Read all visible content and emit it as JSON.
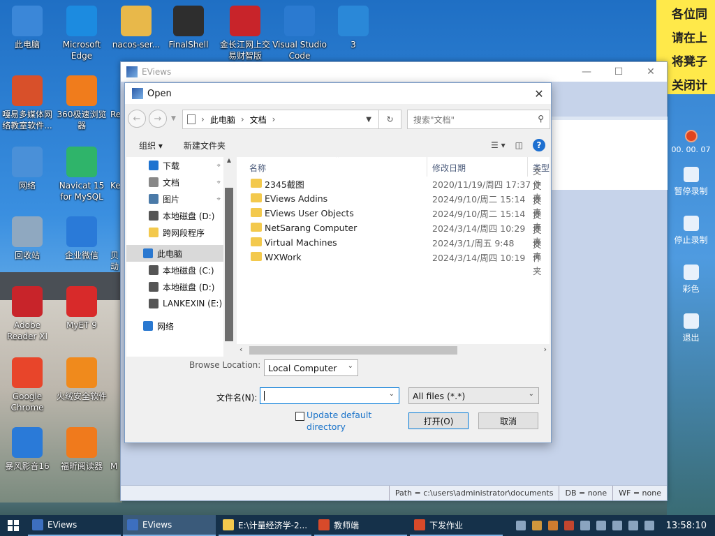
{
  "desktop": {
    "icons": [
      {
        "label": "此电脑",
        "name": "this-pc-icon"
      },
      {
        "label": "Microsoft Edge",
        "name": "edge-icon"
      },
      {
        "label": "nacos-ser...",
        "name": "folder-icon"
      },
      {
        "label": "FinalShell",
        "name": "finalshell-icon"
      },
      {
        "label": "金长江网上交易财智版",
        "name": "trading-app-icon"
      },
      {
        "label": "Visual Studio Code",
        "name": "vscode-icon"
      },
      {
        "label": "3",
        "name": "video-file-icon"
      },
      {
        "label": "嘎易多媒体网络教室软件...",
        "name": "classroom-app-icon"
      },
      {
        "label": "360极速浏览器",
        "name": "browser-360-icon"
      },
      {
        "label": "Re",
        "name": "app-icon"
      },
      {
        "label": "网络",
        "name": "network-icon"
      },
      {
        "label": "Navicat 15 for MySQL",
        "name": "navicat-icon"
      },
      {
        "label": "Ke",
        "name": "app-icon"
      },
      {
        "label": "回收站",
        "name": "recycle-bin-icon"
      },
      {
        "label": "企业微信",
        "name": "wecom-icon"
      },
      {
        "label": "贝动",
        "name": "app-icon"
      },
      {
        "label": "Adobe Reader XI",
        "name": "adobe-reader-icon"
      },
      {
        "label": "MyET 9",
        "name": "myet-icon"
      },
      {
        "label": "Google Chrome",
        "name": "chrome-icon"
      },
      {
        "label": "火绒安全软件",
        "name": "huorong-icon"
      },
      {
        "label": "暴风影音16",
        "name": "baofeng-icon"
      },
      {
        "label": "福昕阅读器",
        "name": "foxit-icon"
      },
      {
        "label": "M",
        "name": "app-icon"
      }
    ],
    "sticky_note": [
      "各位同",
      "请在上",
      "将凳子",
      "关闭计"
    ],
    "recorder": {
      "time": "00. 00. 07",
      "pause": "暂停录制",
      "stop": "停止录制",
      "color": "彩色",
      "exit": "退出"
    }
  },
  "eviews": {
    "title": "EViews",
    "status": {
      "path": "Path = c:\\users\\administrator\\documents",
      "db": "DB = none",
      "wf": "WF = none"
    }
  },
  "dialog": {
    "title": "Open",
    "address": {
      "root": "此电脑",
      "folder": "文档"
    },
    "search_placeholder": "搜索\"文档\"",
    "toolbar": {
      "organize": "组织 ▾",
      "new_folder": "新建文件夹"
    },
    "nav": [
      {
        "label": "下载",
        "pinned": true
      },
      {
        "label": "文档",
        "pinned": true
      },
      {
        "label": "图片",
        "pinned": true
      },
      {
        "label": "本地磁盘 (D:)",
        "pinned": false
      },
      {
        "label": "跨网段程序",
        "pinned": false
      },
      {
        "label": "此电脑",
        "pinned": false,
        "selected": true
      },
      {
        "label": "本地磁盘 (C:)",
        "pinned": false
      },
      {
        "label": "本地磁盘 (D:)",
        "pinned": false
      },
      {
        "label": "LANKEXIN (E:)",
        "pinned": false
      },
      {
        "label": "网络",
        "pinned": false
      }
    ],
    "columns": {
      "name": "名称",
      "date": "修改日期",
      "type": "类型"
    },
    "files": [
      {
        "name": "2345截图",
        "date": "2020/11/19/周四 17:37",
        "type": "文件夹"
      },
      {
        "name": "EViews Addins",
        "date": "2024/9/10/周二 15:14",
        "type": "文件夹"
      },
      {
        "name": "EViews User Objects",
        "date": "2024/9/10/周二 15:14",
        "type": "文件夹"
      },
      {
        "name": "NetSarang Computer",
        "date": "2024/3/14/周四 10:29",
        "type": "文件夹"
      },
      {
        "name": "Virtual Machines",
        "date": "2024/3/1/周五 9:48",
        "type": "文件夹"
      },
      {
        "name": "WXWork",
        "date": "2024/3/14/周四 10:19",
        "type": "文件夹"
      }
    ],
    "browse_location_label": "Browse Location:",
    "browse_location_value": "Local Computer",
    "filename_label": "文件名(N):",
    "filename_value": "",
    "filetype_value": "All files (*.*)",
    "update_default": "Update default directory",
    "open_button": "打开(O)",
    "cancel_button": "取消"
  },
  "taskbar": {
    "tasks": [
      "EViews",
      "EViews",
      "E:\\计量经济学-2...",
      "教师端",
      "下发作业"
    ],
    "clock": "13:58:10"
  }
}
